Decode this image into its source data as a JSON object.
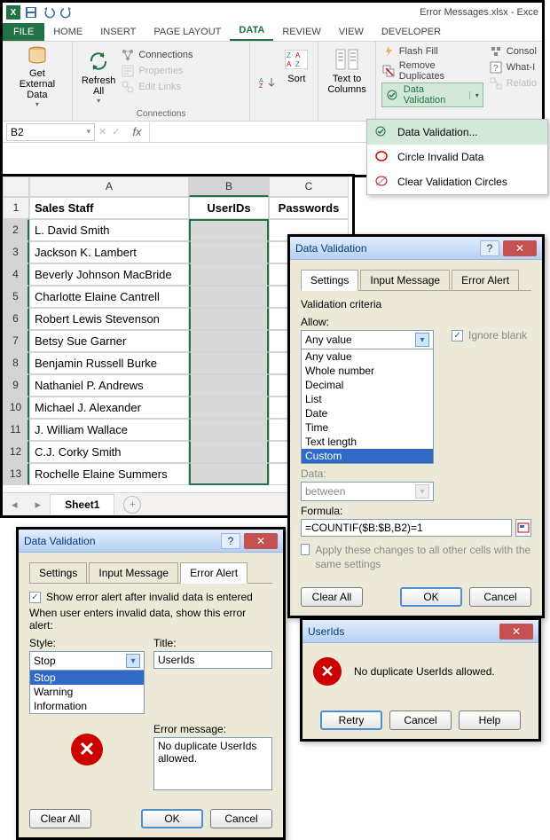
{
  "titlebar": {
    "window_title": "Error Messages.xlsx - Exce"
  },
  "ribbon_tabs": {
    "file": "FILE",
    "home": "HOME",
    "insert": "INSERT",
    "page_layout": "PAGE LAYOUT",
    "data": "DATA",
    "review": "REVIEW",
    "view": "VIEW",
    "developer": "DEVELOPER"
  },
  "ribbon": {
    "get_external_data": "Get External\nData",
    "refresh_all": "Refresh\nAll",
    "connections": "Connections",
    "properties": "Properties",
    "edit_links": "Edit Links",
    "connections_group": "Connections",
    "sort": "Sort",
    "text_to_columns": "Text to\nColumns",
    "flash_fill": "Flash Fill",
    "remove_duplicates": "Remove Duplicates",
    "data_validation": "Data Validation",
    "consolidate": "Consol",
    "whatif": "What-I",
    "relations": "Relatio"
  },
  "dv_menu": {
    "item1": "Data Validation...",
    "item2": "Circle Invalid Data",
    "item3": "Clear Validation Circles"
  },
  "namebox": {
    "value": "B2"
  },
  "grid": {
    "col_a": "A",
    "col_b": "B",
    "col_c": "C",
    "headers": {
      "a": "Sales Staff",
      "b": "UserIDs",
      "c": "Passwords"
    },
    "rows": [
      "L. David Smith",
      "Jackson K. Lambert",
      "Beverly Johnson MacBride",
      "Charlotte Elaine Cantrell",
      "Robert Lewis Stevenson",
      "Betsy Sue Garner",
      "Benjamin Russell Burke",
      "Nathaniel P. Andrews",
      "Michael J. Alexander",
      "J. William Wallace",
      "C.J. Corky Smith",
      "Rochelle Elaine Summers"
    ],
    "sheet_tab": "Sheet1"
  },
  "dv_settings": {
    "title": "Data Validation",
    "tab_settings": "Settings",
    "tab_input": "Input Message",
    "tab_error": "Error Alert",
    "criteria_label": "Validation criteria",
    "allow_label": "Allow:",
    "allow_value": "Any value",
    "ignore_blank": "Ignore blank",
    "options": [
      "Any value",
      "Whole number",
      "Decimal",
      "List",
      "Date",
      "Time",
      "Text length",
      "Custom"
    ],
    "data_label": "Data:",
    "data_value": "between",
    "formula_label": "Formula:",
    "formula_value": "=COUNTIF($B:$B,B2)=1",
    "apply_label": "Apply these changes to all other cells with the same settings",
    "clear_all": "Clear All",
    "ok": "OK",
    "cancel": "Cancel"
  },
  "dv_error": {
    "title": "Data Validation",
    "show_alert": "Show error alert after invalid data is entered",
    "when_label": "When user enters invalid data, show this error alert:",
    "style_label": "Style:",
    "style_value": "Stop",
    "style_options": [
      "Stop",
      "Warning",
      "Information"
    ],
    "title_label": "Title:",
    "title_value": "UserIds",
    "msg_label": "Error message:",
    "msg_value": "No duplicate UserIds allowed.",
    "clear_all": "Clear All",
    "ok": "OK",
    "cancel": "Cancel"
  },
  "msgbox": {
    "title": "UserIds",
    "text": "No duplicate UserIds allowed.",
    "retry": "Retry",
    "cancel": "Cancel",
    "help": "Help"
  }
}
